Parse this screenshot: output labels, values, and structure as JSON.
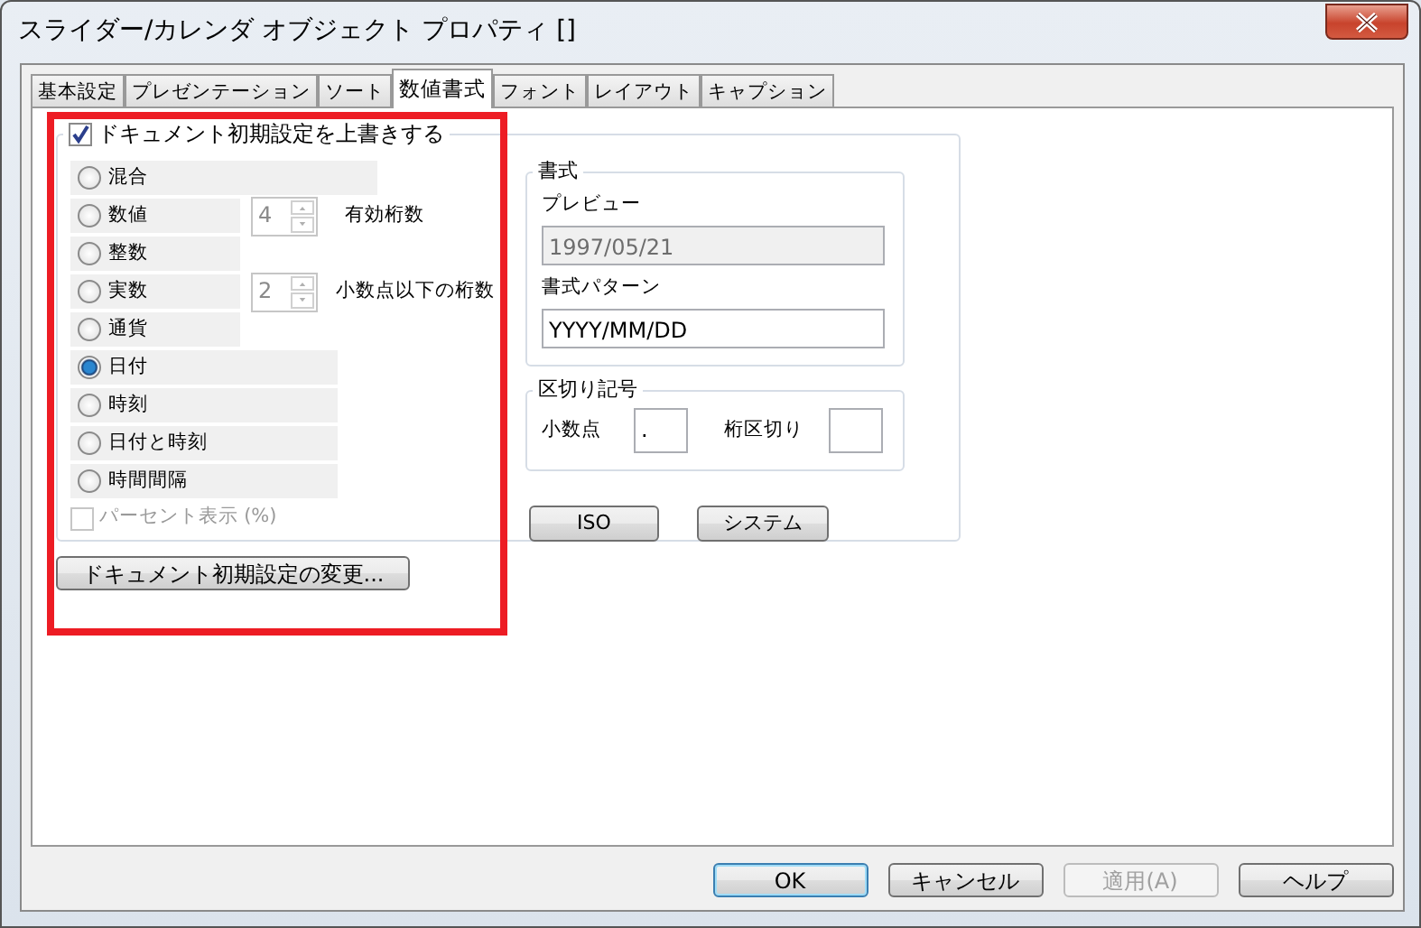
{
  "window": {
    "title": "スライダー/カレンダ オブジェクト プロパティ []"
  },
  "tabs": [
    {
      "label": "基本設定",
      "selected": false
    },
    {
      "label": "プレゼンテーション",
      "selected": false
    },
    {
      "label": "ソート",
      "selected": false
    },
    {
      "label": "数値書式",
      "selected": true
    },
    {
      "label": "フォント",
      "selected": false
    },
    {
      "label": "レイアウト",
      "selected": false
    },
    {
      "label": "キャプション",
      "selected": false
    }
  ],
  "override": {
    "label": "ドキュメント初期設定を上書きする",
    "checked": true
  },
  "number_formats": [
    {
      "label": "混合",
      "selected": false
    },
    {
      "label": "数値",
      "selected": false
    },
    {
      "label": "整数",
      "selected": false
    },
    {
      "label": "実数",
      "selected": false
    },
    {
      "label": "通貨",
      "selected": false
    },
    {
      "label": "日付",
      "selected": true
    },
    {
      "label": "時刻",
      "selected": false
    },
    {
      "label": "日付と時刻",
      "selected": false
    },
    {
      "label": "時間間隔",
      "selected": false
    }
  ],
  "significant_digits": {
    "value": "4",
    "label": "有効桁数",
    "disabled": true
  },
  "decimals": {
    "value": "2",
    "label": "小数点以下の桁数",
    "disabled": true
  },
  "percent": {
    "label": "パーセント表示 (%)",
    "checked": false,
    "disabled": true
  },
  "change_defaults_button": "ドキュメント初期設定の変更...",
  "format": {
    "title": "書式",
    "preview_label": "プレビュー",
    "preview_value": "1997/05/21",
    "pattern_label": "書式パターン",
    "pattern_value": "YYYY/MM/DD"
  },
  "separators": {
    "title": "区切り記号",
    "decimal_label": "小数点",
    "decimal_value": ".",
    "thousands_label": "桁区切り"
  },
  "iso_button": "ISO",
  "system_button": "システム",
  "footer_buttons": [
    {
      "label": "OK",
      "disabled": false,
      "default": true
    },
    {
      "label": "キャンセル",
      "disabled": false,
      "default": false
    },
    {
      "label": "適用(A)",
      "disabled": true,
      "default": false
    },
    {
      "label": "ヘルプ",
      "disabled": false,
      "default": false
    }
  ]
}
